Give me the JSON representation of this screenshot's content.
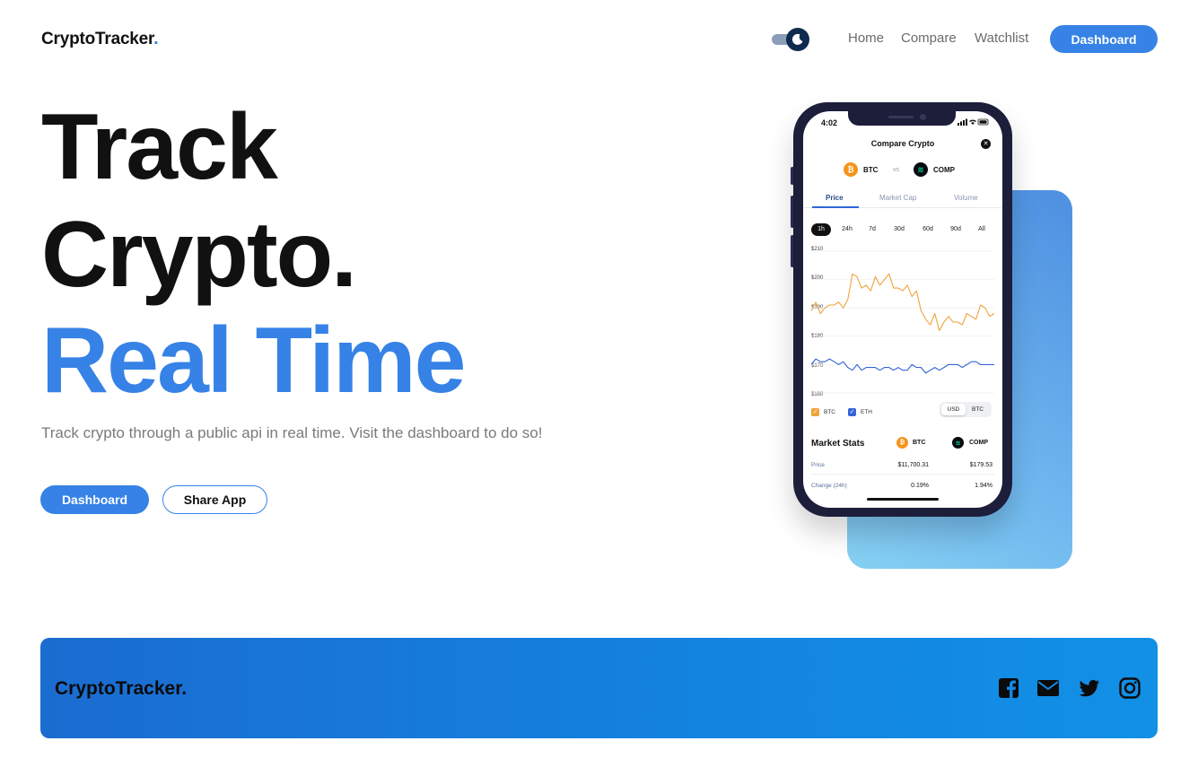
{
  "header": {
    "logo_text": "CryptoTracker",
    "logo_dot": ".",
    "nav": [
      "Home",
      "Compare",
      "Watchlist"
    ],
    "dashboard_label": "Dashboard"
  },
  "hero": {
    "line1": "Track",
    "line2": "Crypto.",
    "line3": "Real Time",
    "subtitle": "Track crypto through a public api in real time. Visit the dashboard to do so!",
    "primary_button": "Dashboard",
    "secondary_button": "Share App"
  },
  "phone": {
    "time": "4:02",
    "title": "Compare Crypto",
    "coin_a": "BTC",
    "vs": "vs",
    "coin_b": "COMP",
    "tabs": [
      "Price",
      "Market Cap",
      "Volume"
    ],
    "ranges": [
      "1h",
      "24h",
      "7d",
      "30d",
      "60d",
      "90d",
      "All"
    ],
    "y_labels": [
      "$210",
      "$200",
      "$190",
      "$180",
      "$170",
      "$160"
    ],
    "legend": [
      "BTC",
      "ETH"
    ],
    "currency": [
      "USD",
      "BTC"
    ],
    "market_stats": {
      "title": "Market Stats",
      "coin_a": "BTC",
      "coin_b": "COMP",
      "rows": [
        {
          "label": "Price",
          "a": "$11,700.31",
          "b": "$179.53"
        },
        {
          "label": "Change (24h)",
          "a": "0.19%",
          "b": "1.94%"
        }
      ]
    }
  },
  "chart_data": {
    "type": "line",
    "ylim": [
      160,
      210
    ],
    "series": [
      {
        "name": "BTC",
        "color": "#f0a33a",
        "values": [
          189,
          192,
          188,
          190,
          191,
          191,
          192,
          190,
          193,
          202,
          201,
          197,
          198,
          196,
          201,
          198,
          200,
          202,
          197,
          197,
          196,
          198,
          194,
          196,
          189,
          186,
          184,
          188,
          182,
          185,
          187,
          185,
          185,
          184,
          188,
          187,
          186,
          191,
          190,
          187,
          188
        ]
      },
      {
        "name": "ETH",
        "color": "#3564d6",
        "values": [
          170,
          172,
          171,
          171,
          172,
          171,
          170,
          171,
          169,
          168,
          170,
          168,
          169,
          169,
          169,
          168,
          169,
          169,
          168,
          169,
          168,
          168,
          170,
          169,
          169,
          167,
          168,
          169,
          168,
          169,
          170,
          170,
          170,
          169,
          170,
          171,
          171,
          170,
          170,
          170,
          170
        ]
      }
    ]
  },
  "footer": {
    "logo_text": "CryptoTracker",
    "logo_dot": "."
  },
  "colors": {
    "accent": "#3682e6",
    "footer_gradient_start": "#1b6cd0",
    "footer_gradient_end": "#1290e6"
  },
  "icons": [
    "moon-icon",
    "facebook-icon",
    "mail-icon",
    "twitter-icon",
    "instagram-icon"
  ]
}
